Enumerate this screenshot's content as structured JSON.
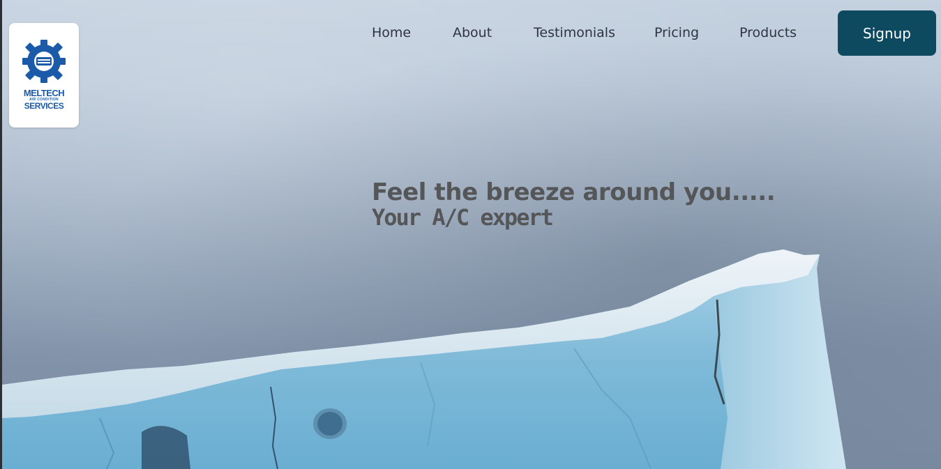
{
  "brand": {
    "logo_line1": "MELTECH",
    "logo_line2": "AIR CONDITION",
    "logo_line3": "SERVICES",
    "color": "#1a5aa8",
    "icon": "gear-icon"
  },
  "nav": {
    "items": [
      {
        "label": "Home"
      },
      {
        "label": "About"
      },
      {
        "label": "Testimonials"
      },
      {
        "label": "Pricing"
      },
      {
        "label": "Products"
      }
    ],
    "signup_label": "Signup",
    "signup_color": "#0e4a5f"
  },
  "hero": {
    "headline": "Feel the breeze around you.....",
    "subline": "Your A/C expert",
    "text_color": "#545658",
    "background": "iceberg-photo"
  }
}
